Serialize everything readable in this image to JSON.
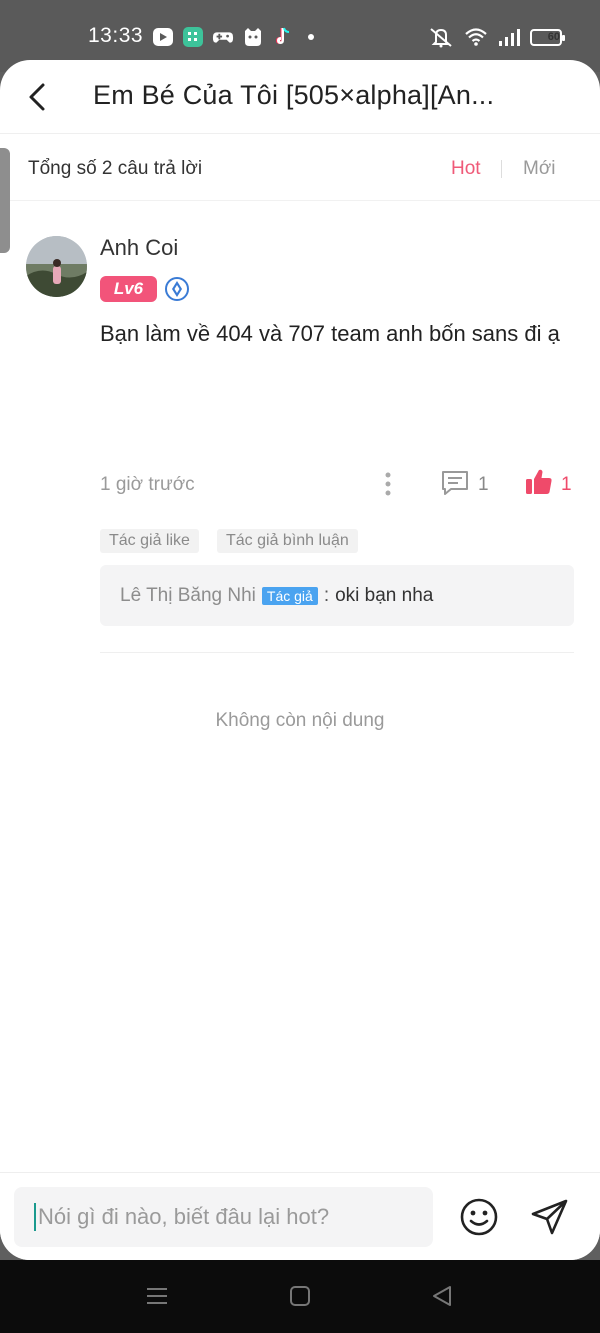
{
  "status_bar": {
    "time": "13:33",
    "battery": "60"
  },
  "header": {
    "title": "Em Bé Của Tôi [505×alpha][An..."
  },
  "filter": {
    "total": "Tổng số 2 câu trả lời",
    "tab_hot": "Hot",
    "tab_new": "Mới"
  },
  "comment": {
    "user_name": "Anh Coi",
    "level": "Lv6",
    "text": "Bạn làm về 404 và 707 team anh bốn sans đi ạ",
    "time_ago": "1 giờ trước",
    "reply_count": "1",
    "like_count": "1",
    "tags": [
      "Tác giả like",
      "Tác giả bình luận"
    ],
    "reply": {
      "author": "Lê Thị Băng Nhi",
      "badge": "Tác giả",
      "colon": ":",
      "text": "oki bạn nha"
    }
  },
  "end_text": "Không còn nội dung",
  "input": {
    "placeholder": "Nói gì đi nào, biết đâu lại hot?"
  },
  "colors": {
    "accent": "#ef5a78",
    "like": "#ef4a6a",
    "author_badge": "#4aa3f0",
    "level_badge": "#f2547a"
  },
  "icons": [
    "back-arrow-icon",
    "medal-icon",
    "more-icon",
    "reply-icon",
    "thumbs-up-icon",
    "emoji-icon",
    "send-icon",
    "nav-menu-icon",
    "nav-home-icon",
    "nav-back-icon"
  ]
}
